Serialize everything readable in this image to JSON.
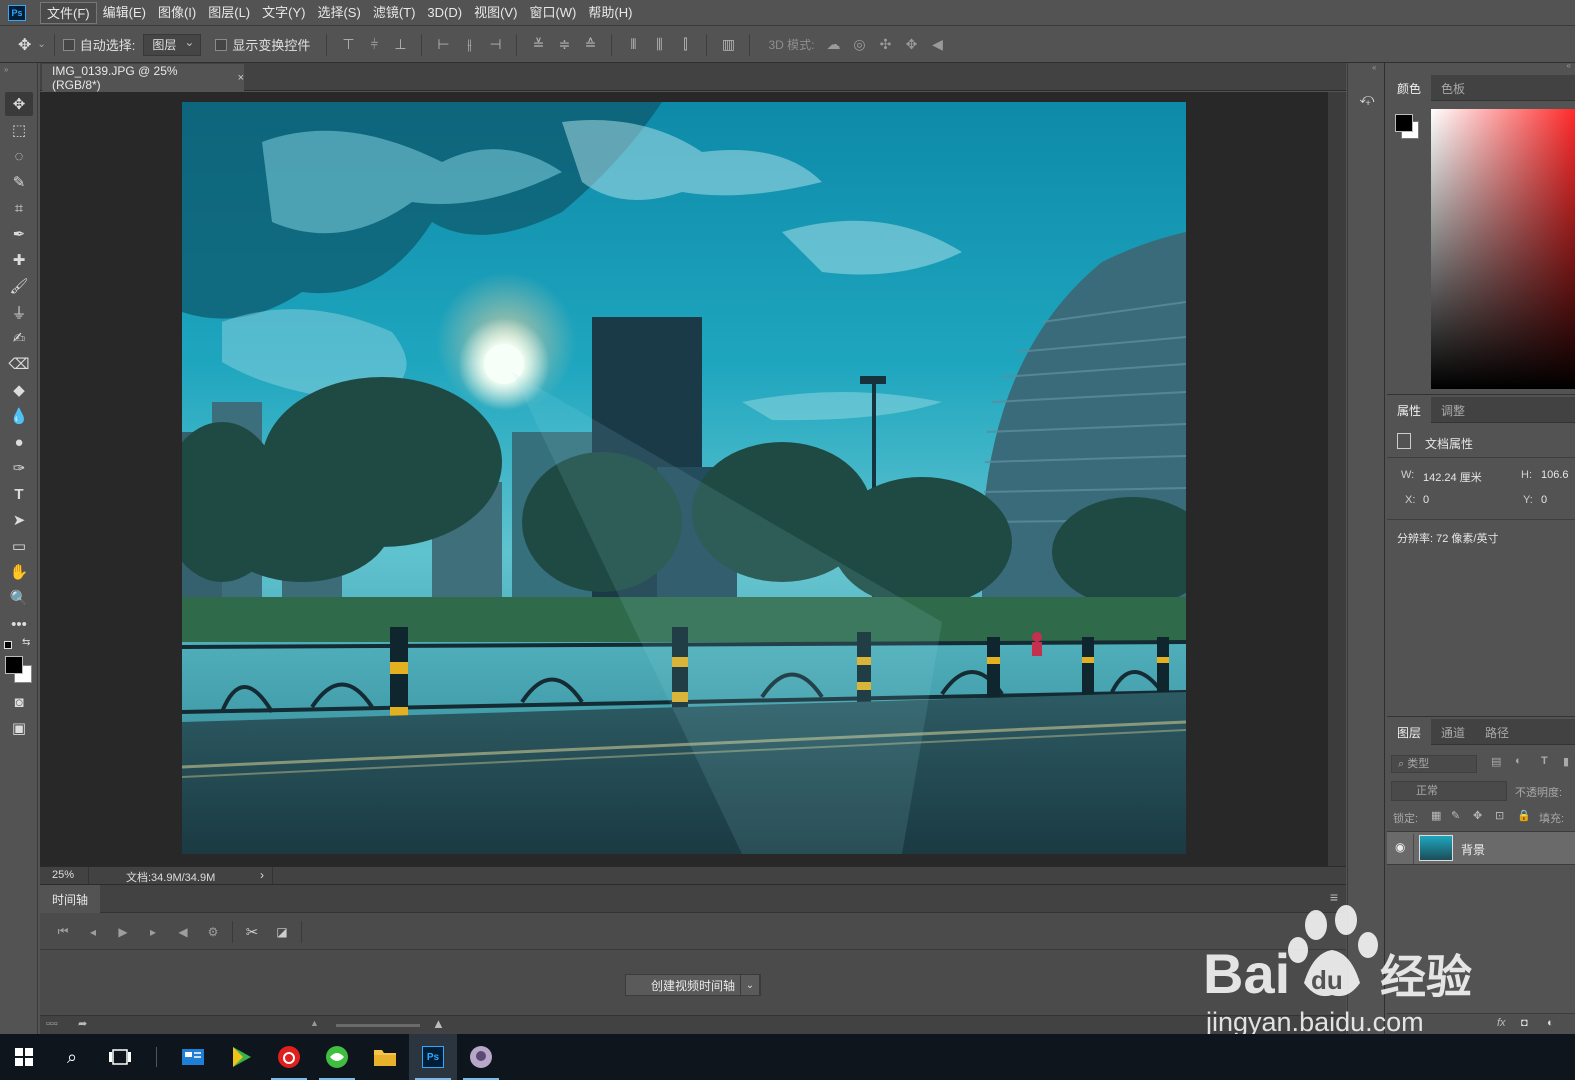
{
  "app": {
    "logo": "Ps"
  },
  "menu": [
    "文件(F)",
    "编辑(E)",
    "图像(I)",
    "图层(L)",
    "文字(Y)",
    "选择(S)",
    "滤镜(T)",
    "3D(D)",
    "视图(V)",
    "窗口(W)",
    "帮助(H)"
  ],
  "options": {
    "auto_select_label": "自动选择:",
    "auto_select_value": "图层",
    "show_transform_label": "显示变换控件",
    "mode3d_label": "3D 模式:"
  },
  "document": {
    "tab_title": "IMG_0139.JPG @ 25%(RGB/8*)",
    "close_glyph": "×",
    "zoom": "25%",
    "doc_size": "文档:34.9M/34.9M",
    "status_arrow": "›"
  },
  "timeline": {
    "tab_label": "时间轴",
    "create_button": "创建视频时间轴",
    "menu_glyph": "≡"
  },
  "color_panel": {
    "tabs": [
      "颜色",
      "色板"
    ]
  },
  "properties_panel": {
    "tabs": [
      "属性",
      "调整"
    ],
    "title": "文档属性",
    "w_label": "W:",
    "w_value": "142.24 厘米",
    "h_label": "H:",
    "h_value": "106.6",
    "x_label": "X:",
    "x_value": "0",
    "y_label": "Y:",
    "y_value": "0",
    "resolution": "分辨率: 72 像素/英寸"
  },
  "layers_panel": {
    "tabs": [
      "图层",
      "通道",
      "路径"
    ],
    "filter_placeholder": "类型",
    "blend_mode": "正常",
    "opacity_label": "不透明度:",
    "lock_label": "锁定:",
    "fill_label": "填充:",
    "layer_name": "背景"
  },
  "watermark": {
    "brand": "Bai",
    "du": "du",
    "jingyan": "经验",
    "url": "jingyan.baidu.com"
  },
  "colors": {
    "sky": "#1fa6bf",
    "accent": "#31a8ff",
    "taskbar": "#0f151c"
  }
}
